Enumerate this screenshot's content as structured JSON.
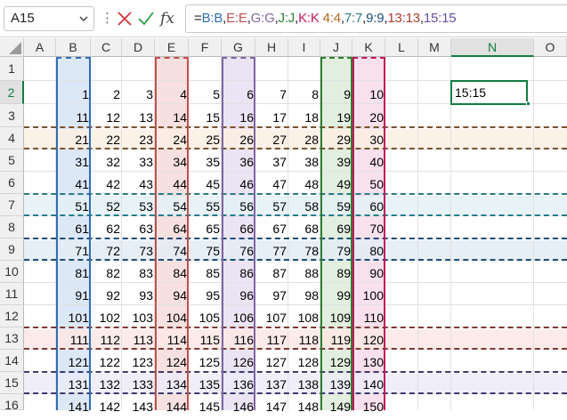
{
  "name_box": {
    "value": "A15"
  },
  "formula_bar": {
    "parts": [
      {
        "text": "=",
        "color": "#222222"
      },
      {
        "text": "B:B",
        "color": "#2f6db5"
      },
      {
        "text": ",",
        "color": "#222222"
      },
      {
        "text": "E:E",
        "color": "#c0504d"
      },
      {
        "text": ",",
        "color": "#222222"
      },
      {
        "text": "G:G",
        "color": "#8064a2"
      },
      {
        "text": ",",
        "color": "#222222"
      },
      {
        "text": "J:J",
        "color": "#2e7d32"
      },
      {
        "text": ",",
        "color": "#222222"
      },
      {
        "text": "K:K",
        "color": "#c2185b"
      },
      {
        "text": " 4:4",
        "color": "#b5651d"
      },
      {
        "text": ",",
        "color": "#222222"
      },
      {
        "text": "7:7",
        "color": "#2a7a8c"
      },
      {
        "text": ",",
        "color": "#222222"
      },
      {
        "text": "9:9",
        "color": "#1f4e79"
      },
      {
        "text": ",",
        "color": "#222222"
      },
      {
        "text": "13:13",
        "color": "#b03a2e"
      },
      {
        "text": ",",
        "color": "#222222"
      },
      {
        "text": "15:15",
        "color": "#6a4ea3"
      }
    ]
  },
  "columns": [
    "A",
    "B",
    "C",
    "D",
    "E",
    "F",
    "G",
    "H",
    "I",
    "J",
    "K",
    "L",
    "M",
    "N",
    "O"
  ],
  "rows": [
    "1",
    "2",
    "3",
    "4",
    "5",
    "6",
    "7",
    "8",
    "9",
    "10",
    "11",
    "12",
    "13",
    "14",
    "15",
    "16"
  ],
  "grid_rows": [
    [],
    [
      "1",
      "2",
      "3",
      "4",
      "5",
      "6",
      "7",
      "8",
      "9",
      "10"
    ],
    [
      "11",
      "12",
      "13",
      "14",
      "15",
      "16",
      "17",
      "18",
      "19",
      "20"
    ],
    [
      "21",
      "22",
      "23",
      "24",
      "25",
      "26",
      "27",
      "28",
      "29",
      "30"
    ],
    [
      "31",
      "32",
      "33",
      "34",
      "35",
      "36",
      "37",
      "38",
      "39",
      "40"
    ],
    [
      "41",
      "42",
      "43",
      "44",
      "45",
      "46",
      "47",
      "48",
      "49",
      "50"
    ],
    [
      "51",
      "52",
      "53",
      "54",
      "55",
      "56",
      "57",
      "58",
      "59",
      "60"
    ],
    [
      "61",
      "62",
      "63",
      "64",
      "65",
      "66",
      "67",
      "68",
      "69",
      "70"
    ],
    [
      "71",
      "72",
      "73",
      "74",
      "75",
      "76",
      "77",
      "78",
      "79",
      "80"
    ],
    [
      "81",
      "82",
      "83",
      "84",
      "85",
      "86",
      "87",
      "88",
      "89",
      "90"
    ],
    [
      "91",
      "92",
      "93",
      "94",
      "95",
      "96",
      "97",
      "98",
      "99",
      "100"
    ],
    [
      "101",
      "102",
      "103",
      "104",
      "105",
      "106",
      "107",
      "108",
      "109",
      "110"
    ],
    [
      "111",
      "112",
      "113",
      "114",
      "115",
      "116",
      "117",
      "118",
      "119",
      "120"
    ],
    [
      "121",
      "122",
      "123",
      "124",
      "125",
      "126",
      "127",
      "128",
      "129",
      "130"
    ],
    [
      "131",
      "132",
      "133",
      "134",
      "135",
      "136",
      "137",
      "138",
      "139",
      "140"
    ],
    [
      "141",
      "142",
      "143",
      "144",
      "145",
      "146",
      "147",
      "148",
      "149",
      "150"
    ]
  ],
  "n2_cell": "15:15",
  "selected_column": "N",
  "selected_row": "2",
  "column_refs": [
    {
      "col": "B",
      "line": "#2f6db5",
      "fill": "#dde8f7"
    },
    {
      "col": "E",
      "line": "#c0504d",
      "fill": "#f6e0e0"
    },
    {
      "col": "G",
      "line": "#8064a2",
      "fill": "#ebe4f4"
    },
    {
      "col": "J",
      "line": "#2e7d32",
      "fill": "#e2efdf"
    },
    {
      "col": "K",
      "line": "#c2185b",
      "fill": "#f8e0ec"
    }
  ],
  "row_refs": [
    {
      "row": "4",
      "line": "#7a5230",
      "fill": "#fbeee3"
    },
    {
      "row": "7",
      "line": "#2a7a8c",
      "fill": "#e3f1f4"
    },
    {
      "row": "9",
      "line": "#1f4e79",
      "fill": "#e3ecf5"
    },
    {
      "row": "13",
      "line": "#7a3b34",
      "fill": "#fbe8e4"
    },
    {
      "row": "15",
      "line": "#3c3a6e",
      "fill": "#ecebf8"
    }
  ]
}
